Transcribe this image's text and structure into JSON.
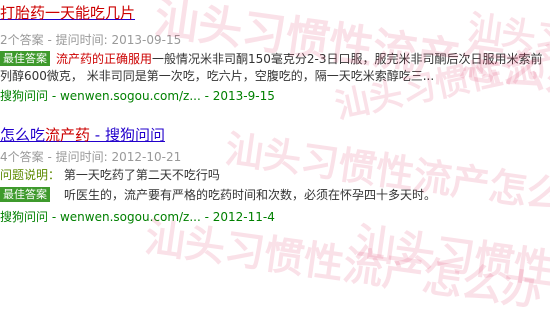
{
  "results": [
    {
      "title": "打胎药一天能吃几片",
      "answer_count": "2个答案",
      "asked_label": "提问时间:",
      "asked_date": "2013-09-15",
      "best_badge": "最佳答案",
      "snippet_highlight": "流产药的正确服用",
      "snippet_rest": "一般情况米非司酮150毫克分2-3日口服，服完米非司酮后次日服用米索前列醇600微克， 米非司同是第一次吃，吃六片，空腹吃的，隔一天吃米索醇吃三...",
      "source_name": "搜狗问问",
      "source_url": "wenwen.sogou.com/z...",
      "source_date": "2013-9-15"
    },
    {
      "title_plain_1": "怎么吃",
      "title_highlight": "流产药",
      "title_plain_2": " - 搜狗问问",
      "answer_count": "4个答案",
      "asked_label": "提问时间:",
      "asked_date": "2012-10-21",
      "question_label": "问题说明：",
      "question_text": "第一天吃药了第二天不吃行吗",
      "best_badge": "最佳答案",
      "answer_text": "听医生的，流产要有严格的吃药时间和次数，必须在怀孕四十多天时。",
      "source_name": "搜狗问问",
      "source_url": "wenwen.sogou.com/z...",
      "source_date": "2012-11-4"
    }
  ],
  "watermark_text": "汕头习惯性流产怎么办",
  "colors": {
    "title_link": "#2200cc",
    "highlight": "#cc0000",
    "meta_gray": "#999999",
    "badge_green": "#3e9a2c",
    "source_green": "#008000",
    "watermark": "#dc285a"
  }
}
